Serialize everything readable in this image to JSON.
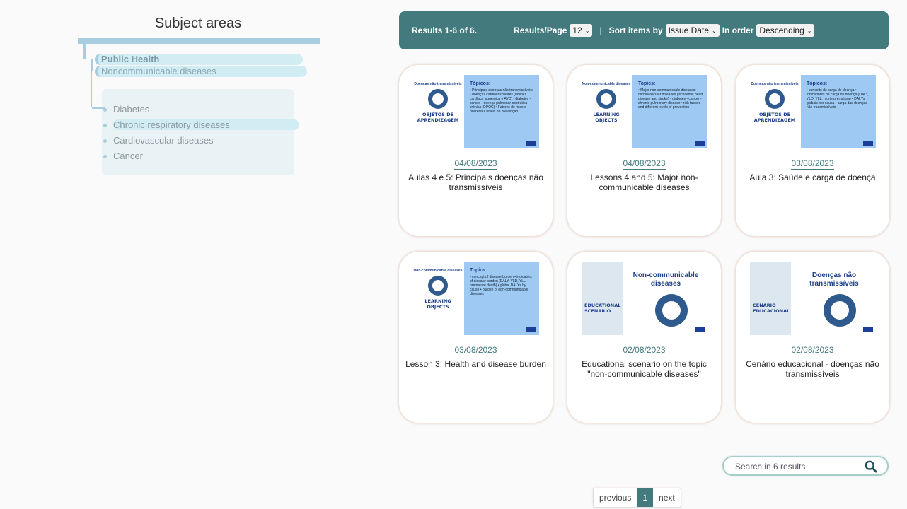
{
  "sidebar": {
    "title": "Subject areas",
    "nodes": [
      "Public Health",
      "Noncommunicable diseases"
    ],
    "items": [
      {
        "label": "Diabetes"
      },
      {
        "label": "Chronic respiratory diseases"
      },
      {
        "label": "Cardiovascular diseases"
      },
      {
        "label": "Cancer"
      }
    ]
  },
  "results": {
    "count_label": "Results 1-6 of 6.",
    "per_page_label": "Results/Page",
    "per_page_value": "12",
    "sep": "|",
    "sort_label": "Sort items by",
    "sort_value": "Issue Date",
    "order_label": "In order",
    "order_value": "Descending"
  },
  "cards": [
    {
      "date": "04/08/2023",
      "title": "Aulas 4 e 5: Principais doenças não transmissíveis",
      "thumb": {
        "heading": "Doenças não transmissíveis",
        "label": "OBJETOS DE APRENDIZAGEM",
        "panel_title": "Tópicos:",
        "panel_text": "• Principais doenças não transmissíveis: - doenças cardiovasculares (doença cardíaca isquémica e AVC) - diabetes - cancro - doença pulmonar obstrutiva crónica (DPOC) • Fatores de risco e diferentes níveis de prevenção"
      }
    },
    {
      "date": "04/08/2023",
      "title": "Lessons 4 and 5: Major non-communicable diseases",
      "thumb": {
        "heading": "Non-communicable diseases",
        "label": "LEARNING OBJECTS",
        "panel_title": "Topics:",
        "panel_text": "• Major non-communicable diseases: - cardiovascular diseases (ischaemic heart disease and stroke) - diabetes - cancer - chronic pulmonary disease • risk factors and different levels of prevention"
      }
    },
    {
      "date": "03/08/2023",
      "title": "Aula 3: Saúde e carga de doença",
      "thumb": {
        "heading": "Doenças não transmissíveis",
        "label": "OBJETOS DE APRENDIZAGEM",
        "panel_title": "Tópicos:",
        "panel_text": "• conceito de carga de doença • indicadores de carga de doença (DALY, YLD, YLL, morte prematura) • DALYs globais por causa • carga das doenças não transmissíveis"
      }
    },
    {
      "date": "03/08/2023",
      "title": "Lesson 3: Health and disease burden",
      "thumb": {
        "heading": "Non-communicable diseases",
        "label": "LEARNING OBJECTS",
        "panel_title": "Topics:",
        "panel_text": "• concept of disease burden • indicators of disease burden (DALY, YLD, YLL, premature death) • global DALYs by cause • burden of non-communicable diseases"
      }
    },
    {
      "date": "02/08/2023",
      "title": "Educational scenario on the topic \"non-communicable diseases\"",
      "thumb": {
        "label": "EDUCATIONAL SCENARIO",
        "wide_title": "Non-communicable diseases"
      }
    },
    {
      "date": "02/08/2023",
      "title": "Cenário educacional - doenças não transmissíveis",
      "thumb": {
        "label": "CENÁRIO EDUCACIONAL",
        "wide_title": "Doenças não transmissíveis"
      }
    }
  ],
  "search": {
    "placeholder": "Search in 6 results"
  },
  "pagination": {
    "previous": "previous",
    "current": "1",
    "next": "next"
  },
  "colors": {
    "accent": "#437a7d",
    "tree": "#a8cddf",
    "thumb_panel": "#9ec9f2"
  }
}
